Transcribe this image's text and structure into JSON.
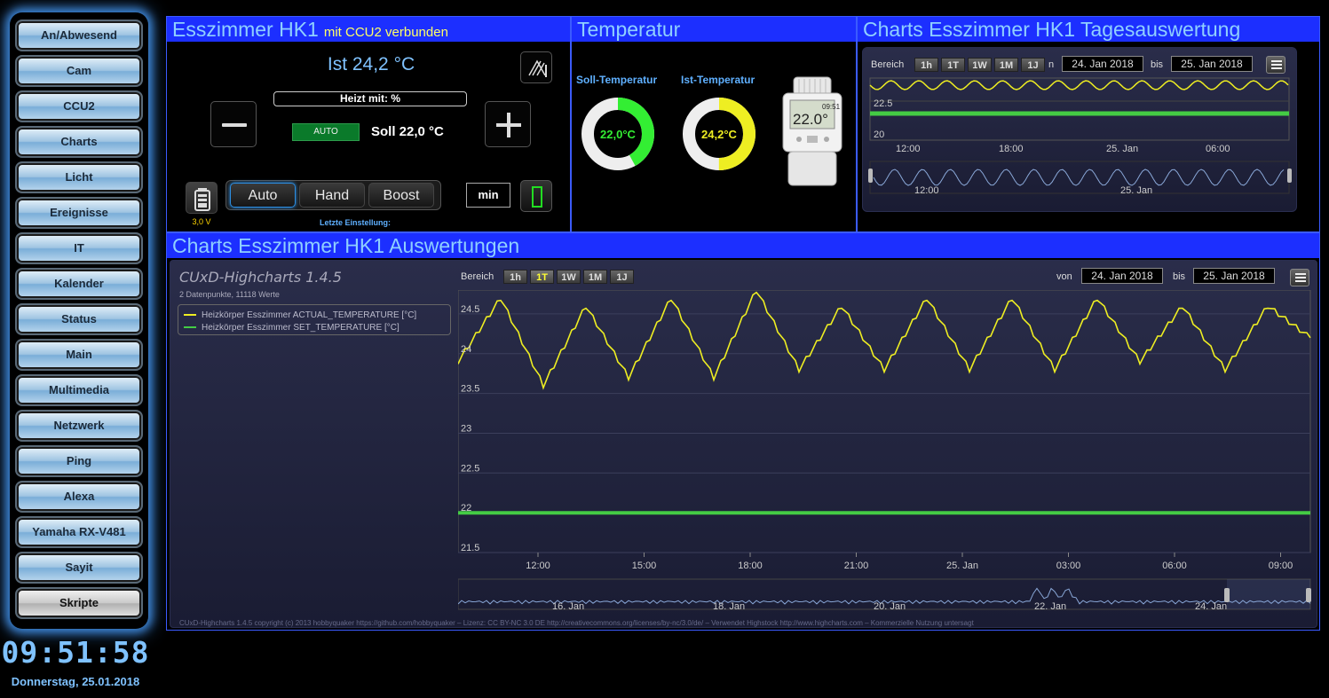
{
  "sidebar": {
    "items": [
      {
        "label": "An/Abwesend"
      },
      {
        "label": "Cam"
      },
      {
        "label": "CCU2"
      },
      {
        "label": "Charts"
      },
      {
        "label": "Licht"
      },
      {
        "label": "Ereignisse"
      },
      {
        "label": "IT"
      },
      {
        "label": "Kalender"
      },
      {
        "label": "Status"
      },
      {
        "label": "Main"
      },
      {
        "label": "Multimedia"
      },
      {
        "label": "Netzwerk"
      },
      {
        "label": "Ping"
      },
      {
        "label": "Alexa"
      },
      {
        "label": "Yamaha RX-V481"
      },
      {
        "label": "Sayit"
      },
      {
        "label": "Skripte"
      }
    ],
    "active_index": 16
  },
  "clock": {
    "time": "09:51:58",
    "date": "Donnerstag, 25.01.2018"
  },
  "room_panel": {
    "title": "Esszimmer HK1",
    "subtitle": "mit CCU2 verbunden",
    "ist": "Ist 24,2 °C",
    "heizt": "Heizt mit: %",
    "auto_badge": "AUTO",
    "soll": "Soll 22,0 °C",
    "battery_voltage": "3,0 V",
    "modes": [
      "Auto",
      "Hand",
      "Boost"
    ],
    "selected_mode": "Auto",
    "letzte": "Letzte Einstellung:",
    "min_label": "min"
  },
  "temp_panel": {
    "title": "Temperatur",
    "soll_label": "Soll-Temperatur",
    "ist_label": "Ist-Temperatur",
    "soll_value": "22,0°C",
    "ist_value": "24,2°C",
    "soll_fraction": 0.42,
    "ist_fraction": 0.5,
    "device_display_time": "09:51",
    "device_display_temp": "22.0°",
    "colors": {
      "soll": "#33ee33",
      "ist": "#eeee22"
    }
  },
  "tages_panel": {
    "title": "Charts Esszimmer HK1 Tagesauswertung",
    "bereich": "Bereich",
    "ranges": [
      "1h",
      "1T",
      "1W",
      "1M",
      "1J"
    ],
    "selected_range": "",
    "von_fragment": "n",
    "von": "24. Jan 2018",
    "bis_label": "bis",
    "bis": "25. Jan 2018",
    "y_ticks": [
      "22.5",
      "20"
    ],
    "x_ticks": [
      "12:00",
      "18:00",
      "25. Jan",
      "06:00"
    ],
    "nav_ticks": [
      "12:00",
      "25. Jan"
    ]
  },
  "auswert_panel": {
    "title": "Charts Esszimmer HK1 Auswertungen",
    "hc_title": "CUxD-Highcharts 1.4.5",
    "hc_sub": "2 Datenpunkte, 11118 Werte",
    "bereich": "Bereich",
    "ranges": [
      "1h",
      "1T",
      "1W",
      "1M",
      "1J"
    ],
    "selected_range": "1T",
    "von_label": "von",
    "von": "24. Jan 2018",
    "bis_label": "bis",
    "bis": "25. Jan 2018",
    "copyright": "CUxD-Highcharts 1.4.5 copyright (c) 2013 hobbyquaker https://github.com/hobbyquaker – Lizenz: CC BY-NC 3.0 DE http://creativecommons.org/licenses/by-nc/3.0/de/ – Verwendet Highstock http://www.highcharts.com – Kommerzielle Nutzung untersagt",
    "nav_ticks": [
      "16. Jan",
      "18. Jan",
      "20. Jan",
      "22. Jan",
      "24. Jan"
    ]
  },
  "chart_data": {
    "type": "line",
    "x": [
      "12:00",
      "15:00",
      "18:00",
      "21:00",
      "25. Jan",
      "03:00",
      "06:00",
      "09:00"
    ],
    "ylim": [
      21.5,
      24.8
    ],
    "y_ticks": [
      "24.5",
      "24",
      "23.5",
      "23",
      "22.5",
      "22",
      "21.5"
    ],
    "series": [
      {
        "name": "Heizkörper Esszimmer ACTUAL_TEMPERATURE [°C]",
        "color": "#eeee22",
        "values": [
          23.9,
          24.7,
          23.6,
          24.6,
          23.7,
          24.7,
          23.7,
          24.8,
          23.8,
          24.6,
          23.8,
          24.7,
          23.8,
          24.7,
          23.8,
          24.7,
          23.9,
          24.6,
          23.8,
          24.6,
          24.2
        ]
      },
      {
        "name": "Heizkörper Esszimmer SET_TEMPERATURE [°C]",
        "color": "#44cc44",
        "values": [
          22.0,
          22.0,
          22.0,
          22.0,
          22.0,
          22.0,
          22.0,
          22.0,
          22.0,
          22.0,
          22.0,
          22.0,
          22.0,
          22.0,
          22.0,
          22.0,
          22.0,
          22.0,
          22.0,
          22.0,
          22.0
        ]
      }
    ]
  }
}
